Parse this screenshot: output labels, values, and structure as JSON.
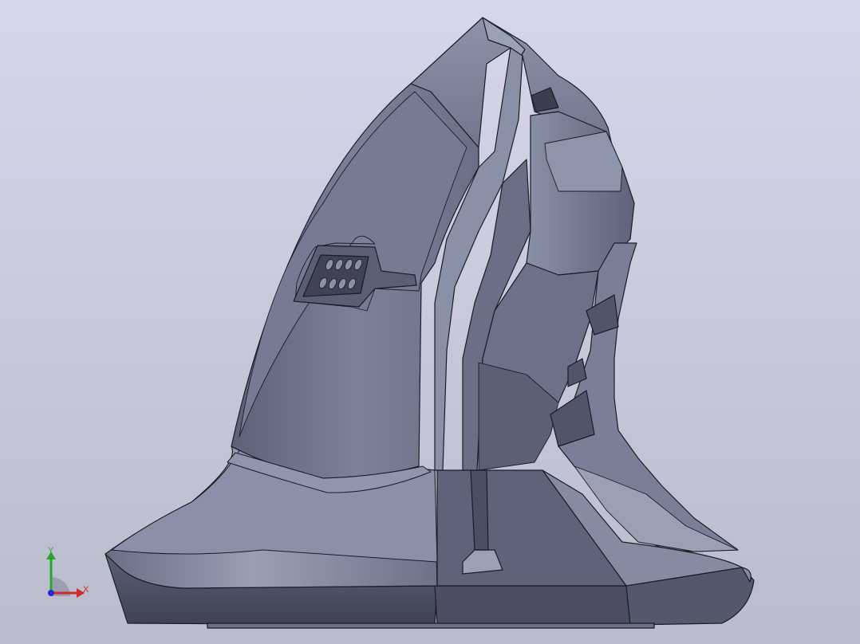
{
  "viewport": {
    "background_top": "#d4d4e8",
    "background_bottom": "#babccb"
  },
  "model": {
    "name": "ergonomic-vertical-mouse-body",
    "shade_light": "#8e94aa",
    "shade_mid": "#747a92",
    "shade_dark": "#4f5468",
    "edge_color": "#1a1c26"
  },
  "triad": {
    "x_label": "X",
    "y_label": "Y",
    "x_color": "#d22a2a",
    "y_color": "#2aa82a",
    "z_color": "#2a2ad2"
  }
}
